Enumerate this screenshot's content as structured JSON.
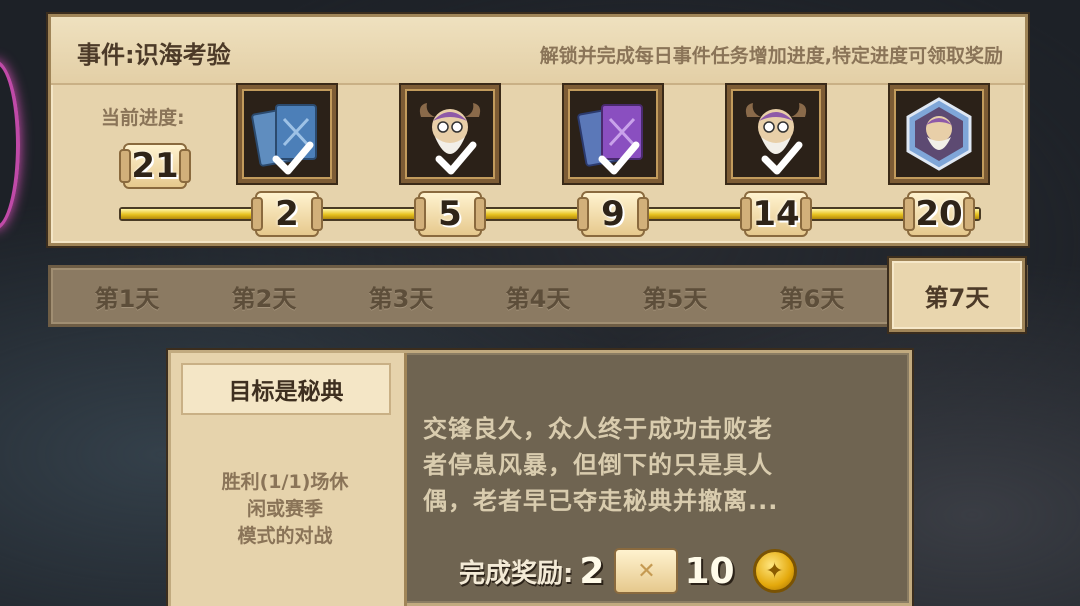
{
  "event": {
    "title": "事件:识海考验",
    "description": "解锁并完成每日事件任务增加进度,特定进度可领取奖励",
    "progress_label": "当前进度:",
    "current_progress": "21",
    "progress_fraction": 1.0,
    "milestones": [
      {
        "value": "2",
        "reward_icon": "blue-card-pack-icon",
        "claimed": true
      },
      {
        "value": "5",
        "reward_icon": "elder-portrait-icon",
        "claimed": true
      },
      {
        "value": "9",
        "reward_icon": "purple-card-pack-icon",
        "claimed": true
      },
      {
        "value": "14",
        "reward_icon": "elder-portrait-icon",
        "claimed": true
      },
      {
        "value": "20",
        "reward_icon": "elder-avatar-frame-icon",
        "claimed": false
      }
    ]
  },
  "days": {
    "tabs": [
      "第1天",
      "第2天",
      "第3天",
      "第4天",
      "第5天",
      "第6天",
      "第7天"
    ],
    "active_index": 6
  },
  "task": {
    "title": "目标是秘典",
    "description_lines": [
      "胜利(1/1)场休",
      "闲或赛季",
      "模式的对战"
    ],
    "story_lines": [
      "交锋良久，众人终于成功击败老",
      "者停息风暴，但倒下的只是具人",
      "偶，老者早已夺走秘典并撤离..."
    ],
    "reward_label": "完成奖励:",
    "reward_scroll_count": "2",
    "reward_coin_count": "10"
  },
  "colors": {
    "parchment": "#e6d3ac",
    "gold_bar": "#e7c21f",
    "tab_bar": "#8b7a62",
    "text_brown": "#4c3a28"
  }
}
